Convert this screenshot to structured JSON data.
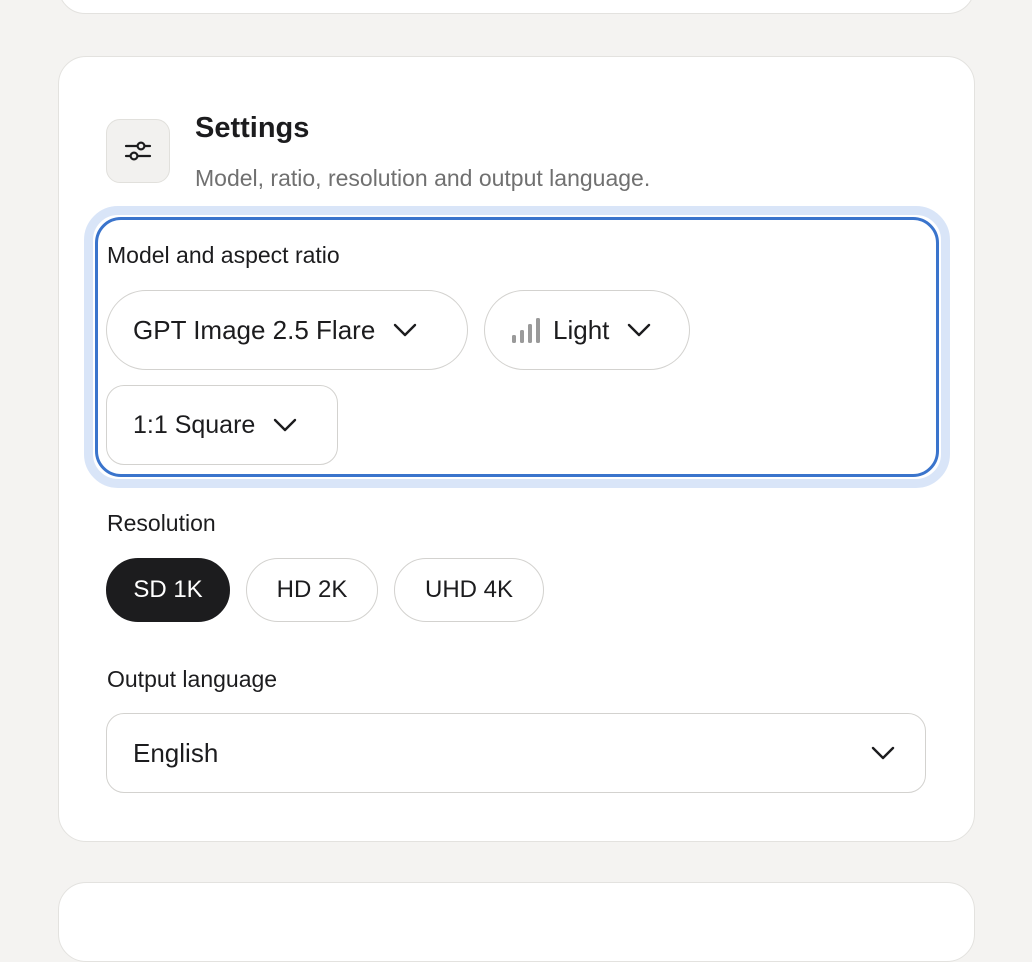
{
  "settings": {
    "title": "Settings",
    "subtitle": "Model, ratio, resolution and output language.",
    "icon": "sliders-icon"
  },
  "model_section": {
    "label": "Model and aspect ratio",
    "model_value": "GPT Image 2.5 Flare",
    "quality_value": "Light",
    "quality_icon": "signal-bars-icon",
    "ratio_value": "1:1 Square",
    "focus_color": "#3a74cc"
  },
  "resolution": {
    "label": "Resolution",
    "options": [
      "SD 1K",
      "HD 2K",
      "UHD 4K"
    ],
    "selected": "SD 1K"
  },
  "output_language": {
    "label": "Output language",
    "value": "English"
  }
}
